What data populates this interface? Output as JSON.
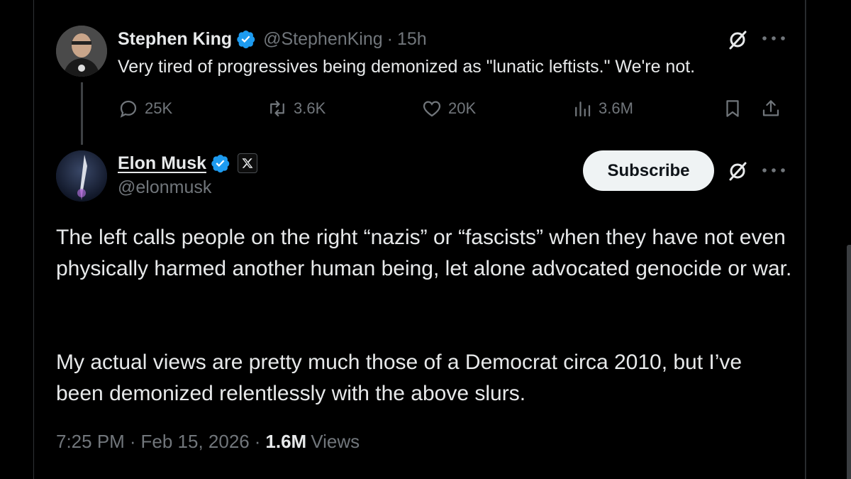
{
  "parent": {
    "display_name": "Stephen King",
    "handle": "@StephenKing",
    "separator": "·",
    "age": "15h",
    "text": "Very tired of progressives being demonized as \"lunatic leftists.\" We're not.",
    "stats": {
      "replies": "25K",
      "reposts": "3.6K",
      "likes": "20K",
      "views": "3.6M"
    }
  },
  "tweet": {
    "display_name": "Elon Musk",
    "handle": "@elonmusk",
    "subscribe_label": "Subscribe",
    "paragraphs": [
      "The left calls people on the right “nazis” or “fascists” when they have not even physically harmed another human being, let alone advocated genocide or war.",
      "My actual views are pretty much those of a Democrat circa 2010, but I’ve been demonized relentlessly with the above slurs."
    ],
    "time": "7:25 PM",
    "date": "Feb 15, 2026",
    "separator": "·",
    "views_count": "1.6M",
    "views_label": "Views"
  },
  "colors": {
    "background": "#000000",
    "text_primary": "#e7e9ea",
    "text_secondary": "#71767b",
    "verified_blue": "#1d9bf0",
    "subscribe_bg": "#eff3f4"
  },
  "icons": {
    "reply": "reply-icon",
    "repost": "repost-icon",
    "like": "heart-icon",
    "views": "views-icon",
    "bookmark": "bookmark-icon",
    "share": "share-icon",
    "grok": "grok-icon",
    "more": "more-icon",
    "verified": "verified-badge-icon",
    "affiliate": "x-affiliate-icon"
  }
}
